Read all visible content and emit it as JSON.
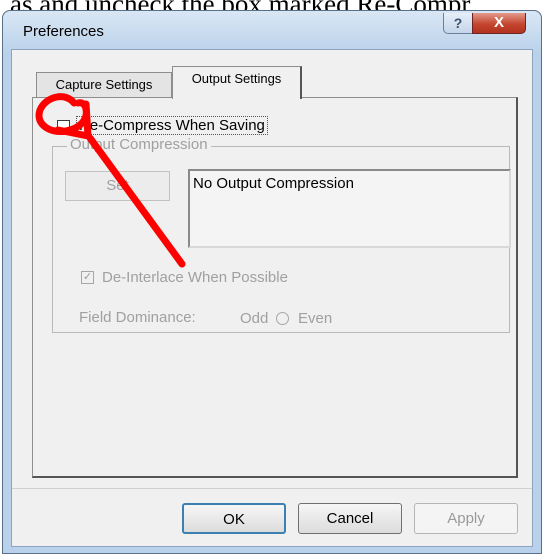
{
  "document_text": "as and uncheck the box marked Re-Compr",
  "window": {
    "title": "Preferences",
    "help_label": "?",
    "close_label": "X"
  },
  "tabs": [
    {
      "label": "Capture Settings",
      "active": false
    },
    {
      "label": "Output Settings",
      "active": true
    }
  ],
  "output_settings": {
    "recompress_label": "Re-Compress When Saving",
    "recompress_checked": false,
    "group_label": "Output Compression",
    "set_button_label": "Set",
    "compression_value": "No Output Compression",
    "deinterlace_label": "De-Interlace When Possible",
    "deinterlace_checked": true,
    "field_dominance_label": "Field Dominance:",
    "odd_label": "Odd",
    "even_label": "Even"
  },
  "buttons": {
    "ok": "OK",
    "cancel": "Cancel",
    "apply": "Apply"
  },
  "annotation_color": "#ff0000"
}
